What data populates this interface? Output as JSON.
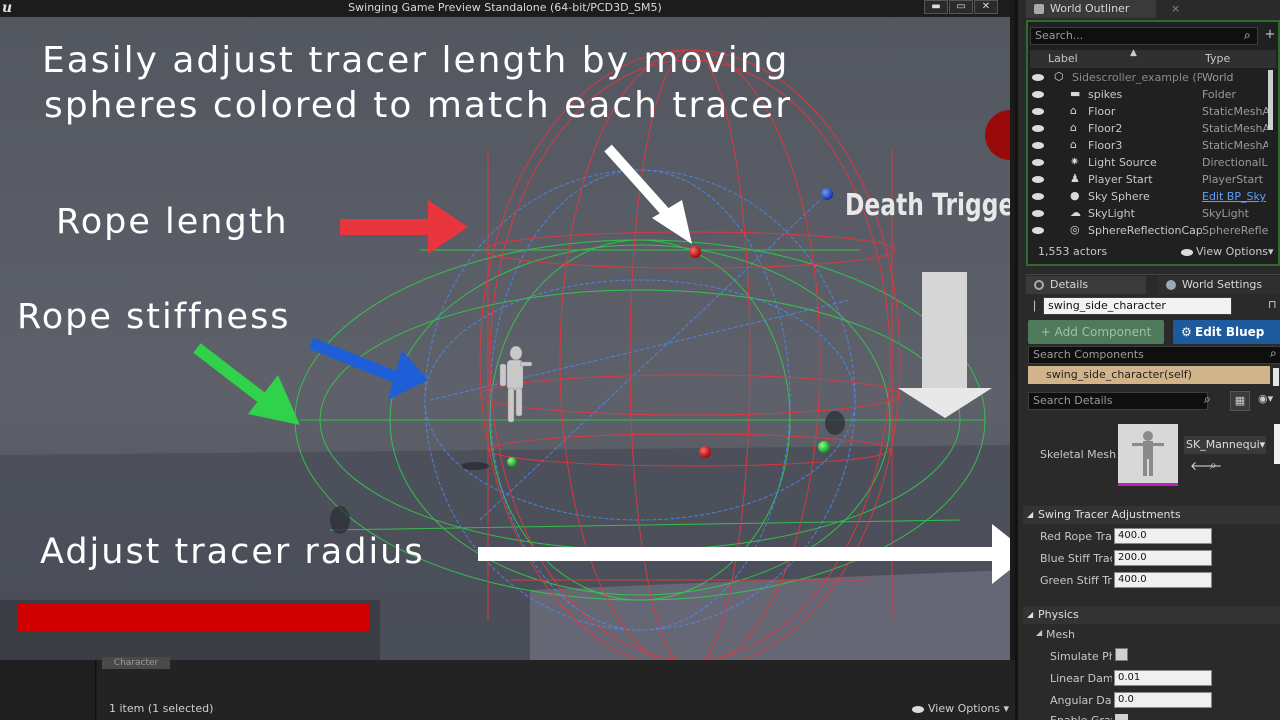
{
  "window": {
    "title": "Swinging Game Preview Standalone (64-bit/PCD3D_SM5)",
    "logo": "u",
    "btn_minimize": "▬",
    "btn_maximize": "▭",
    "btn_close": "✕"
  },
  "overlay": {
    "line1": "Easily adjust tracer length by moving",
    "line2": "spheres colored to match each tracer",
    "rope_length": "Rope length",
    "rope_stiffness": "Rope stiffness",
    "adjust_radius": "Adjust tracer radius",
    "death_trigger": "Death Trigge"
  },
  "colors": {
    "red": "#e8353e",
    "blue": "#1e5fd8",
    "green": "#2fd24a",
    "white": "#ffffff",
    "healthbar": "#d10000"
  },
  "outliner": {
    "tab": "World Outliner",
    "search_placeholder": "Search...",
    "col_label": "Label",
    "col_type": "Type",
    "rows": [
      {
        "label": "Sidescroller_example (P",
        "type": "World",
        "icon": "world-icon"
      },
      {
        "label": "spikes",
        "type": "Folder",
        "icon": "folder-icon"
      },
      {
        "label": "Floor",
        "type": "StaticMeshA",
        "icon": "static-mesh-icon"
      },
      {
        "label": "Floor2",
        "type": "StaticMeshA",
        "icon": "static-mesh-icon"
      },
      {
        "label": "Floor3",
        "type": "StaticMeshA",
        "icon": "static-mesh-icon"
      },
      {
        "label": "Light Source",
        "type": "DirectionalL",
        "icon": "light-icon"
      },
      {
        "label": "Player Start",
        "type": "PlayerStart",
        "icon": "player-start-icon"
      },
      {
        "label": "Sky Sphere",
        "type": "Edit BP_Sky",
        "icon": "sphere-icon"
      },
      {
        "label": "SkyLight",
        "type": "SkyLight",
        "icon": "skylight-icon"
      },
      {
        "label": "SphereReflectionCap",
        "type": "SphereRefle",
        "icon": "reflection-icon"
      }
    ],
    "actor_count": "1,553 actors",
    "view_options": "View Options"
  },
  "details": {
    "tab_details": "Details",
    "tab_world_settings": "World Settings",
    "actor_name": "swing_side_character",
    "add_component": "+ Add Component",
    "edit_blueprint": "Edit Bluep",
    "search_components_placeholder": "Search Components",
    "self_component": "swing_side_character(self)",
    "search_details_placeholder": "Search Details",
    "skeletal_mesh_label": "Skeletal Mesh",
    "skeletal_mesh_value": "SK_Mannequi",
    "swing_section": "Swing Tracer Adjustments",
    "red_label": "Red Rope Trac",
    "red_value": "400.0",
    "blue_label": "Blue Stiff Trac",
    "blue_value": "200.0",
    "green_label": "Green Stiff Tra",
    "green_value": "400.0",
    "physics_section": "Physics",
    "mesh_section": "Mesh",
    "simulate_label": "Simulate Ph",
    "linear_label": "Linear Damp",
    "linear_value": "0.01",
    "angular_label": "Angular Dam",
    "angular_value": "0.0",
    "enable_label": "Enable Grav"
  },
  "bottom": {
    "content_tab": "Character",
    "selection": "1 item (1 selected)",
    "view_options": "View Options"
  }
}
